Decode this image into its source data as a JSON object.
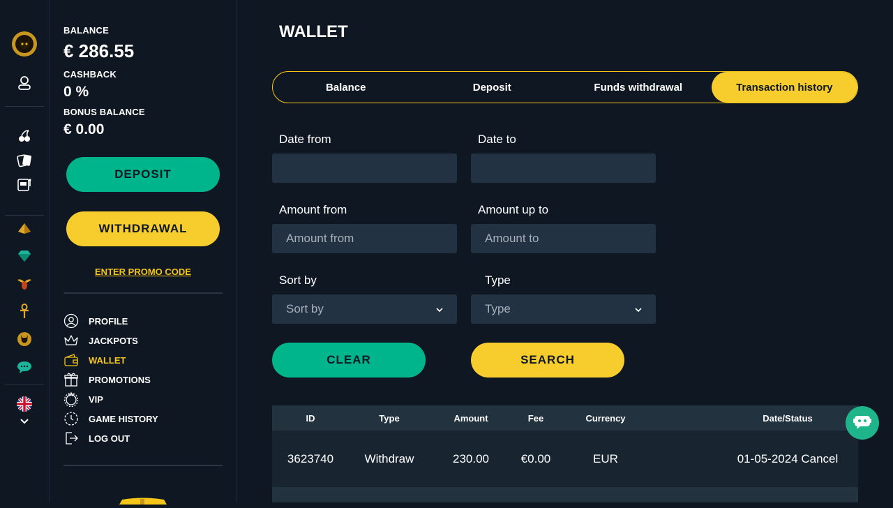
{
  "colors": {
    "background": "#0f1722",
    "input_bg": "#223242",
    "accent_yellow": "#f7cd2e",
    "accent_green": "#00b48c",
    "text": "#ffffff"
  },
  "rail": {
    "icons": [
      "cat-logo-icon",
      "user-icon",
      "cherries-icon",
      "cards-icon",
      "slot-machine-icon",
      "gold-pyramid-icon",
      "gem-icon",
      "scarab-icon",
      "ankh-icon",
      "cat-icon",
      "chat-bubble-icon",
      "uk-flag-icon",
      "chevron-down-icon"
    ]
  },
  "account": {
    "balance_label": "BALANCE",
    "balance_value": "€ 286.55",
    "cashback_label": "CASHBACK",
    "cashback_value": "0 %",
    "bonus_label": "BONUS BALANCE",
    "bonus_value": "€ 0.00",
    "deposit_button": "DEPOSIT",
    "withdrawal_button": "WITHDRAWAL",
    "promo_link": "ENTER PROMO CODE"
  },
  "menu": {
    "items": [
      {
        "label": "PROFILE",
        "icon": "profile-icon"
      },
      {
        "label": "JACKPOTS",
        "icon": "crown-icon"
      },
      {
        "label": "WALLET",
        "icon": "wallet-icon",
        "active": true
      },
      {
        "label": "PROMOTIONS",
        "icon": "gift-icon"
      },
      {
        "label": "VIP",
        "icon": "vip-icon"
      },
      {
        "label": "GAME HISTORY",
        "icon": "history-icon"
      },
      {
        "label": "LOG OUT",
        "icon": "logout-icon"
      }
    ]
  },
  "main": {
    "title": "WALLET",
    "tabs": [
      {
        "label": "Balance"
      },
      {
        "label": "Deposit"
      },
      {
        "label": "Funds withdrawal"
      },
      {
        "label": "Transaction history",
        "active": true
      }
    ],
    "filters": {
      "date_from_label": "Date from",
      "date_to_label": "Date to",
      "amount_from_label": "Amount from",
      "amount_from_placeholder": "Amount from",
      "amount_to_label": "Amount up to",
      "amount_to_placeholder": "Amount to",
      "sort_label": "Sort by",
      "sort_value": "Sort by",
      "type_label": "Type",
      "type_value": "Type"
    },
    "clear_button": "CLEAR",
    "search_button": "SEARCH",
    "table": {
      "headers": [
        "ID",
        "Type",
        "Amount",
        "Fee",
        "Currency",
        "Date/Status"
      ],
      "rows": [
        [
          "3623740",
          "Withdraw",
          "230.00",
          "€0.00",
          "EUR",
          "01-05-2024 Cancel"
        ]
      ]
    }
  }
}
